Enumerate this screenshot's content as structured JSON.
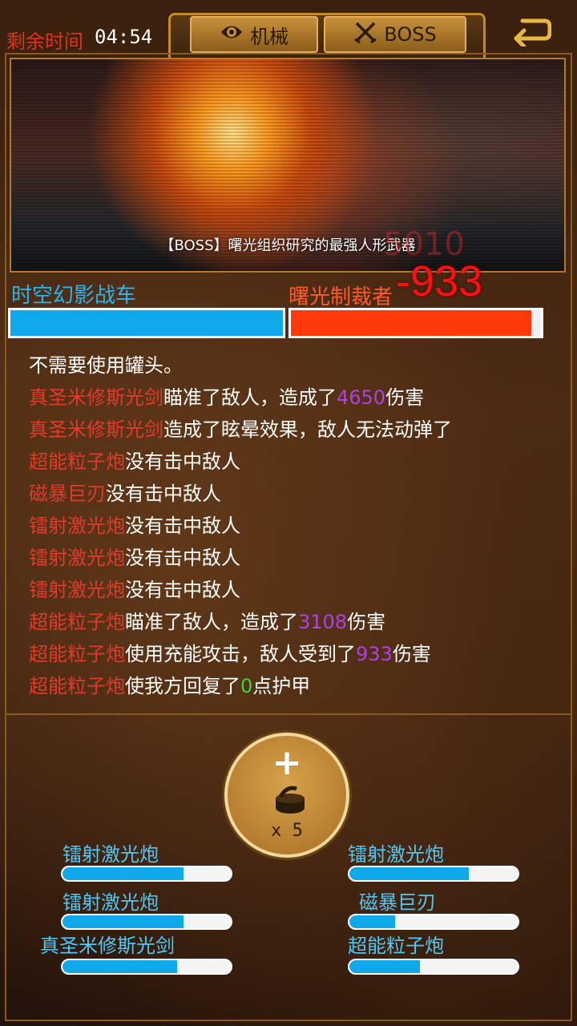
{
  "header": {
    "timer_label": "剩余时间",
    "timer_value": "04:54",
    "tabs": [
      {
        "label": "机械",
        "icon": "eye-icon"
      },
      {
        "label": "BOSS",
        "icon": "crossed-swords-icon"
      }
    ],
    "back_icon": "back-arrow-icon"
  },
  "scene": {
    "caption": "【BOSS】曙光组织研究的最强人形武器",
    "ghost_number": "5010"
  },
  "combat": {
    "player_name": "时空幻影战车",
    "enemy_name": "曙光制裁者",
    "damage_popup": "-933",
    "player_hp_fraction": 1.0,
    "enemy_hp_fraction": 0.96,
    "colors": {
      "player": "#0fa8ea",
      "enemy": "#ff3a0a"
    }
  },
  "log": [
    [
      {
        "t": "不需要使用罐头。",
        "c": "t"
      }
    ],
    [
      {
        "t": "真圣米修斯光剑",
        "c": "w"
      },
      {
        "t": "瞄准了敌人，造成了",
        "c": "t"
      },
      {
        "t": "4650",
        "c": "n"
      },
      {
        "t": "伤害",
        "c": "t"
      }
    ],
    [
      {
        "t": "真圣米修斯光剑",
        "c": "w"
      },
      {
        "t": "造成了眩晕效果，敌人无法动弹了",
        "c": "t"
      }
    ],
    [
      {
        "t": "超能粒子炮",
        "c": "w"
      },
      {
        "t": "没有击中敌人",
        "c": "t"
      }
    ],
    [
      {
        "t": "磁暴巨刃",
        "c": "w"
      },
      {
        "t": "没有击中敌人",
        "c": "t"
      }
    ],
    [
      {
        "t": "镭射激光炮",
        "c": "w"
      },
      {
        "t": "没有击中敌人",
        "c": "t"
      }
    ],
    [
      {
        "t": "镭射激光炮",
        "c": "w"
      },
      {
        "t": "没有击中敌人",
        "c": "t"
      }
    ],
    [
      {
        "t": "镭射激光炮",
        "c": "w"
      },
      {
        "t": "没有击中敌人",
        "c": "t"
      }
    ],
    [
      {
        "t": "超能粒子炮",
        "c": "w"
      },
      {
        "t": "瞄准了敌人，造成了",
        "c": "t"
      },
      {
        "t": "3108",
        "c": "n"
      },
      {
        "t": "伤害",
        "c": "t"
      }
    ],
    [
      {
        "t": "超能粒子炮",
        "c": "w"
      },
      {
        "t": "使用充能攻击，敌人受到了",
        "c": "t"
      },
      {
        "t": "933",
        "c": "n"
      },
      {
        "t": "伤害",
        "c": "t"
      }
    ],
    [
      {
        "t": "超能粒子炮",
        "c": "w"
      },
      {
        "t": "使我方回复了",
        "c": "t"
      },
      {
        "t": "0",
        "c": "g"
      },
      {
        "t": "点护甲",
        "c": "t"
      }
    ]
  ],
  "can_button": {
    "plus": "+",
    "count": "x 5",
    "icon": "food-can-icon"
  },
  "weapons_left": [
    {
      "name": "镭射激光炮",
      "charge": 0.72
    },
    {
      "name": "镭射激光炮",
      "charge": 0.72
    },
    {
      "name": "真圣米修斯光剑",
      "charge": 0.68
    }
  ],
  "weapons_right": [
    {
      "name": "镭射激光炮",
      "charge": 0.71
    },
    {
      "name": "磁暴巨刃",
      "charge": 0.27
    },
    {
      "name": "超能粒子炮",
      "charge": 0.42
    }
  ]
}
